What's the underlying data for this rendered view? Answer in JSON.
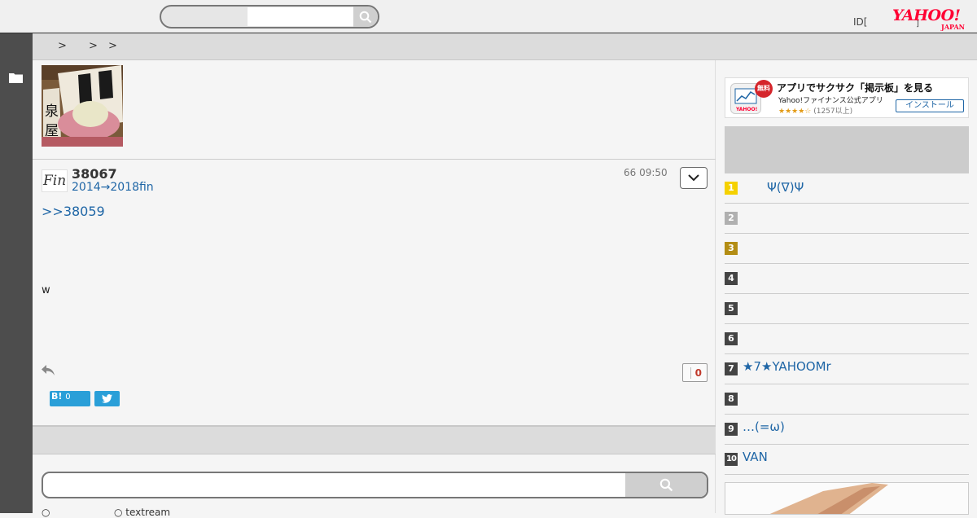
{
  "header": {
    "search_placeholder": "",
    "id_text": "ID[",
    "mark_text": "]",
    "logo_main": "YAHOO!",
    "logo_sub": "JAPAN"
  },
  "breadcrumb": [
    ">",
    ">",
    ">"
  ],
  "post": {
    "number": "38067",
    "author": "2014→2018fin",
    "avatar_text": "Fin",
    "time": "66 09:50",
    "anchor": ">>38059",
    "body": "w",
    "like_count": "0",
    "hatena_label": "B!",
    "hatena_count": "0"
  },
  "bottom": {
    "search_placeholder": "",
    "radio_1": "○",
    "radio_2": "○ textream"
  },
  "ad": {
    "badge": "無料",
    "title": "アプリでサクサク「掲示板」を見る",
    "subtitle": "Yahoo!ファイナンス公式アプリ",
    "stars": "★★★★☆",
    "review_count": "(1257以上)",
    "install_label": "インストール"
  },
  "ranking": [
    {
      "num": "1",
      "text": "　　Ψ(∇)Ψ",
      "color": "#f5d100"
    },
    {
      "num": "2",
      "text": "",
      "color": "#b0b0b0"
    },
    {
      "num": "3",
      "text": "",
      "color": "#b38d14"
    },
    {
      "num": "4",
      "text": "",
      "color": "#444444"
    },
    {
      "num": "5",
      "text": "",
      "color": "#444444"
    },
    {
      "num": "6",
      "text": "",
      "color": "#444444"
    },
    {
      "num": "7",
      "text": "★7★YAHOOMr",
      "color": "#444444"
    },
    {
      "num": "8",
      "text": "",
      "color": "#444444"
    },
    {
      "num": "9",
      "text": "…(=ω)",
      "color": "#444444"
    },
    {
      "num": "10",
      "text": "VAN",
      "color": "#444444"
    }
  ],
  "colors": {
    "link": "#1f66a6",
    "rail": "#4d4d4d",
    "brand": "#ff0033",
    "share": "#2a9fd8"
  }
}
